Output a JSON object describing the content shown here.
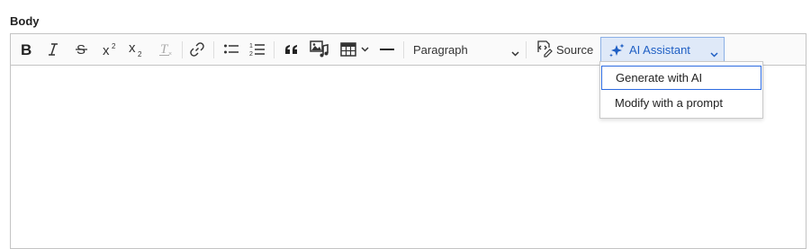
{
  "field": {
    "label": "Body"
  },
  "toolbar": {
    "buttons": [
      {
        "name": "bold-button",
        "icon": "bold-icon"
      },
      {
        "name": "italic-button",
        "icon": "italic-icon"
      },
      {
        "name": "strikethrough-button",
        "icon": "strikethrough-icon"
      },
      {
        "name": "superscript-button",
        "icon": "superscript-icon"
      },
      {
        "name": "subscript-button",
        "icon": "subscript-icon"
      },
      {
        "name": "remove-format-button",
        "icon": "remove-format-icon"
      },
      {
        "name": "link-button",
        "icon": "link-icon"
      },
      {
        "name": "bulleted-list-button",
        "icon": "bulleted-list-icon"
      },
      {
        "name": "numbered-list-button",
        "icon": "numbered-list-icon"
      },
      {
        "name": "blockquote-button",
        "icon": "blockquote-icon"
      },
      {
        "name": "media-button",
        "icon": "media-icon"
      },
      {
        "name": "table-button",
        "icon": "table-icon"
      },
      {
        "name": "horizontal-line-button",
        "icon": "horizontal-line-icon"
      }
    ],
    "heading_select": {
      "value": "Paragraph"
    },
    "source_label": "Source",
    "ai_assistant_label": "AI Assistant",
    "accent_color": "#1f5fc4"
  },
  "ai_menu": {
    "items": [
      {
        "label": "Generate with AI",
        "focused": true
      },
      {
        "label": "Modify with a prompt",
        "focused": false
      }
    ]
  }
}
